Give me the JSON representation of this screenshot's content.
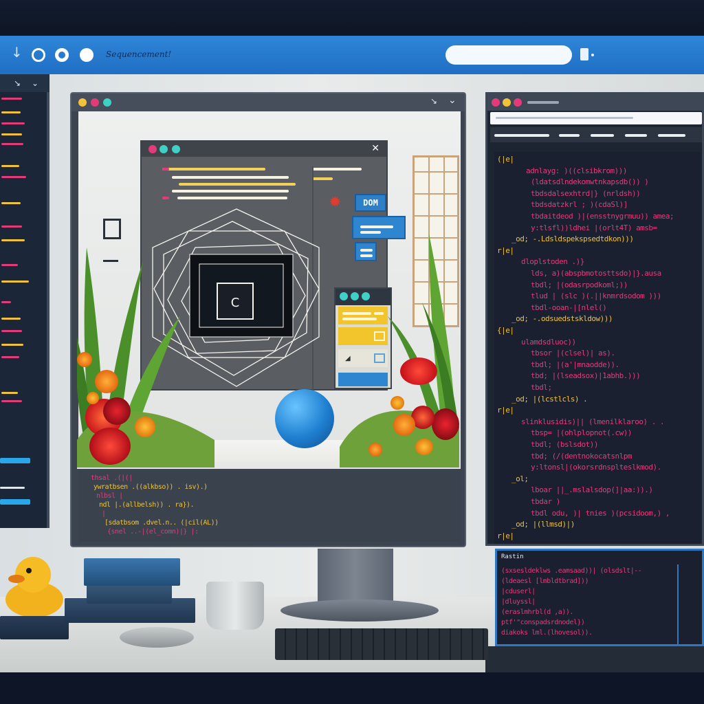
{
  "topbar": {
    "title": "Sequencement!",
    "search_placeholder": "",
    "icons": [
      "down-arrow-icon",
      "circle-icon",
      "ring-icon",
      "badge-icon",
      "extension-icon"
    ]
  },
  "left_panel": {
    "colors": [
      "#e33b7a",
      "#f0c23b",
      "#e33b7a",
      "#f0c23b"
    ]
  },
  "main_window": {
    "dom_badge": "DOM",
    "inner_icon": "C",
    "code_lines": [
      "thsal .(|(|",
      "  ywratbsen .((alkbso)) . isv).)",
      "  nlbsl |",
      "  ndl |.(allbelsh)) . ra}).",
      "   |",
      "  [sdatbsom .dvel.n.. (|cil(AL))",
      "  {snel ..-|(el_comn)|} |:"
    ]
  },
  "code_panel": {
    "lines": [
      {
        "indent": 0,
        "text": "(|e|",
        "color": "#f0c23b"
      },
      {
        "indent": 6,
        "text": "adnlayg: )((clsibkrom)))",
        "color": "#e33b7a"
      },
      {
        "indent": 7,
        "text": "(ldatsdlndekomwtnkapsdb()) )",
        "color": "#e33b7a"
      },
      {
        "indent": 7,
        "text": "tbdsdalsexhtrd|} (nrldsh))",
        "color": "#e33b7a"
      },
      {
        "indent": 7,
        "text": "tbdsdatzkrl ; )(cdaSl)]",
        "color": "#e33b7a"
      },
      {
        "indent": 7,
        "text": "tbdaitdeod )|(ensstnygrmuu)) amea;",
        "color": "#e33b7a"
      },
      {
        "indent": 7,
        "text": "y:tlsfl))ldhei |(orlt4T) amsb=",
        "color": "#e33b7a"
      },
      {
        "indent": 3,
        "text": "_od; -.Ldsldspekspsedtdkon)))",
        "color": "#f0c23b"
      },
      {
        "indent": 0,
        "text": "r|e|",
        "color": "#f0c23b"
      },
      {
        "indent": 5,
        "text": "dloplstoden .)}",
        "color": "#e33b7a"
      },
      {
        "indent": 7,
        "text": "lds, a)(abspbmotosttsdo)|}.ausa",
        "color": "#e33b7a"
      },
      {
        "indent": 7,
        "text": "tbdl; |(odasrpodkoml;))",
        "color": "#e33b7a"
      },
      {
        "indent": 7,
        "text": "tlud | (slc )(.||knmrdsodom )))",
        "color": "#e33b7a"
      },
      {
        "indent": 7,
        "text": "tbdl-ooan-|[nlel()",
        "color": "#e33b7a"
      },
      {
        "indent": 3,
        "text": "_od; -.odsuedstskldow)))",
        "color": "#f0c23b"
      },
      {
        "indent": 0,
        "text": "{|e|",
        "color": "#f0c23b"
      },
      {
        "indent": 5,
        "text": "ulamdsdluoc))",
        "color": "#e33b7a"
      },
      {
        "indent": 7,
        "text": "tbsor |(clsel)| as).",
        "color": "#e33b7a"
      },
      {
        "indent": 7,
        "text": "tbdl; |(a'|mnaodde)).",
        "color": "#e33b7a"
      },
      {
        "indent": 7,
        "text": "tbd; |(lseadsox)|1abhb.)))",
        "color": "#e33b7a"
      },
      {
        "indent": 7,
        "text": "tbdl;",
        "color": "#e33b7a"
      },
      {
        "indent": 3,
        "text": "_od; |(lcstlcls) .",
        "color": "#f0c23b"
      },
      {
        "indent": 0,
        "text": "r|e|",
        "color": "#f0c23b"
      },
      {
        "indent": 5,
        "text": "slinklusidis)|| (lmenilklaroo) . .",
        "color": "#e33b7a"
      },
      {
        "indent": 7,
        "text": "tbsp= |(ohlplopnot(.cw))",
        "color": "#e33b7a"
      },
      {
        "indent": 7,
        "text": "tbdl; (bslsdot))",
        "color": "#e33b7a"
      },
      {
        "indent": 7,
        "text": "tbd; (/(dentnokocatsnlpm",
        "color": "#e33b7a"
      },
      {
        "indent": 7,
        "text": "y:ltonsl|(okorsrdnsplteslkmod).",
        "color": "#e33b7a"
      },
      {
        "indent": 3,
        "text": "_ol;",
        "color": "#f0c23b"
      },
      {
        "indent": 7,
        "text": "lboar ||_.mslalsdop(]|aa:)).)",
        "color": "#e33b7a"
      },
      {
        "indent": 7,
        "text": "tbdar )",
        "color": "#e33b7a"
      },
      {
        "indent": 7,
        "text": "tbdl odu, )| tnies )(pcsidoom,) ,",
        "color": "#e33b7a"
      },
      {
        "indent": 3,
        "text": "_od; |(llmsd)|)",
        "color": "#f0c23b"
      },
      {
        "indent": 0,
        "text": "r|e|",
        "color": "#f0c23b"
      }
    ]
  },
  "console": {
    "header": "Rastin",
    "lines": [
      {
        "text": "(sxsesldeklws .eamsaad))| (olsdslt|--",
        "color": "#e33b7a"
      },
      {
        "text": "(ldeaesl  [lmbldtbrad]))",
        "color": "#e33b7a"
      },
      {
        "text": "|cduserl|",
        "color": "#e33b7a"
      },
      {
        "text": "|dluyssl|",
        "color": "#e33b7a"
      },
      {
        "text": "(eraslmhrbl(d ,a)).",
        "color": "#e33b7a"
      },
      {
        "text": "ptf'\"conspadsrdnodel})",
        "color": "#e33b7a"
      },
      {
        "text": "diakoks  lml.(lhovesol)).",
        "color": "#e33b7a"
      }
    ]
  },
  "colors": {
    "accent_blue": "#2f86d8",
    "code_pink": "#e33b7a",
    "code_yellow": "#f0c23b",
    "panel_bg": "#1d2432"
  }
}
